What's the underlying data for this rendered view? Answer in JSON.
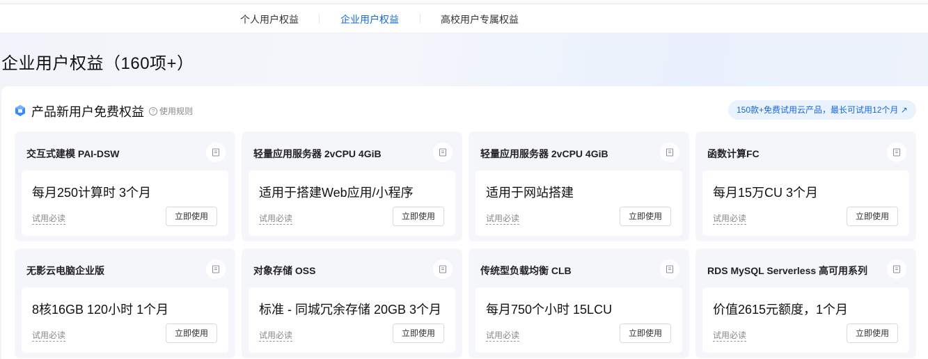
{
  "tabs": [
    {
      "label": "个人用户权益"
    },
    {
      "label": "企业用户权益",
      "active": true
    },
    {
      "label": "高校用户专属权益"
    }
  ],
  "page_title": "企业用户权益（160项+）",
  "section": {
    "title": "产品新用户免费权益",
    "rules_label": "使用规则",
    "promo_label": "150款+免费试用云产品，最长可试用12个月",
    "promo_arrow": "↗"
  },
  "colors": {
    "accent": "#1668dc",
    "card_bg": "#f4f6f9"
  },
  "cards": [
    {
      "name": "交互式建模 PAI-DSW",
      "desc": "每月250计算时 3个月",
      "read": "试用必读",
      "button": "立即使用"
    },
    {
      "name": "轻量应用服务器 2vCPU 4GiB",
      "desc": "适用于搭建Web应用/小程序",
      "read": "试用必读",
      "button": "立即使用"
    },
    {
      "name": "轻量应用服务器 2vCPU 4GiB",
      "desc": "适用于网站搭建",
      "read": "试用必读",
      "button": "立即使用"
    },
    {
      "name": "函数计算FC",
      "desc": "每月15万CU 3个月",
      "read": "试用必读",
      "button": "立即使用"
    },
    {
      "name": "无影云电脑企业版",
      "desc": "8核16GB 120小时 1个月",
      "read": "试用必读",
      "button": "立即使用"
    },
    {
      "name": "对象存储 OSS",
      "desc": "标准 - 同城冗余存储 20GB 3个月",
      "read": "试用必读",
      "button": "立即使用"
    },
    {
      "name": "传统型负载均衡 CLB",
      "desc": "每月750个小时 15LCU",
      "read": "试用必读",
      "button": "立即使用"
    },
    {
      "name": "RDS MySQL Serverless 高可用系列",
      "desc": "价值2615元额度，1个月",
      "read": "试用必读",
      "button": "立即使用"
    }
  ]
}
